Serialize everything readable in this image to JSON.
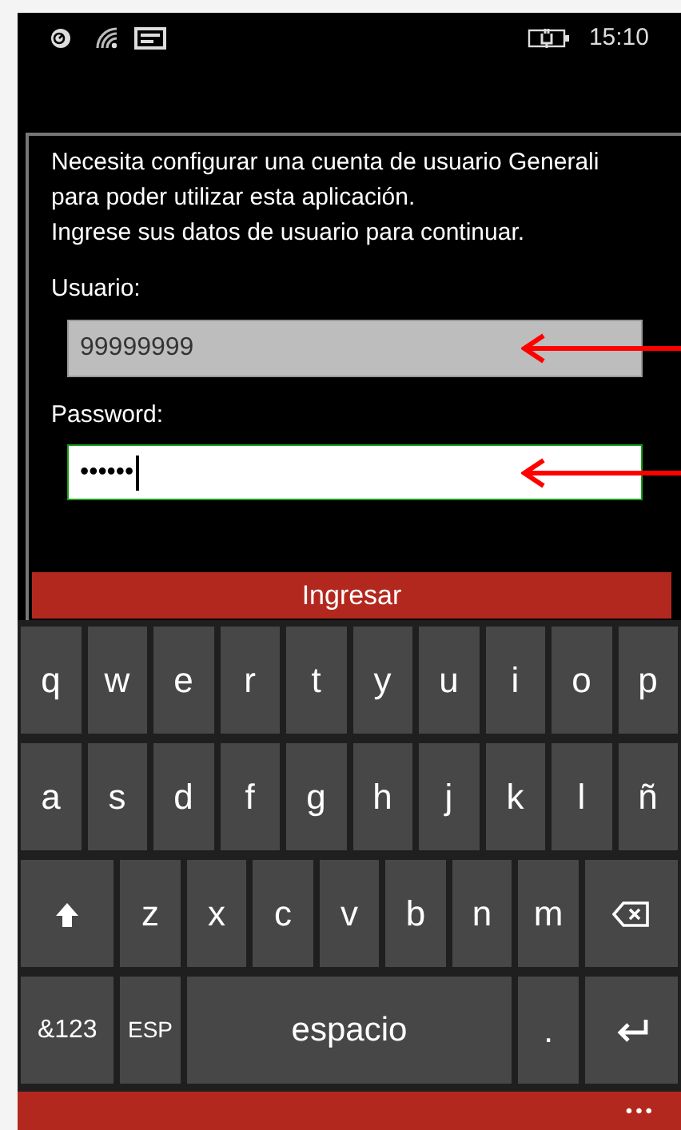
{
  "status_bar": {
    "time": "15:10"
  },
  "message": [
    "Necesita configurar una cuenta de usuario Generali para poder utilizar esta aplicación.",
    "Ingrese sus datos de usuario para continuar."
  ],
  "fields": [
    {
      "label": "Usuario:",
      "value": "99999999",
      "focused": false,
      "annotated": true
    },
    {
      "label": "Password:",
      "value": "••••••",
      "focused": true,
      "annotated": true
    }
  ],
  "button": "Ingresar",
  "keyboard": {
    "rows": [
      {
        "keys": [
          {
            "kind": "char",
            "label": "q"
          },
          {
            "kind": "char",
            "label": "w"
          },
          {
            "kind": "char",
            "label": "e"
          },
          {
            "kind": "char",
            "label": "r"
          },
          {
            "kind": "char",
            "label": "t"
          },
          {
            "kind": "char",
            "label": "y"
          },
          {
            "kind": "char",
            "label": "u"
          },
          {
            "kind": "char",
            "label": "i"
          },
          {
            "kind": "char",
            "label": "o"
          },
          {
            "kind": "char",
            "label": "p"
          }
        ]
      },
      {
        "keys": [
          {
            "kind": "char",
            "label": "a"
          },
          {
            "kind": "char",
            "label": "s"
          },
          {
            "kind": "char",
            "label": "d"
          },
          {
            "kind": "char",
            "label": "f"
          },
          {
            "kind": "char",
            "label": "g"
          },
          {
            "kind": "char",
            "label": "h"
          },
          {
            "kind": "char",
            "label": "j"
          },
          {
            "kind": "char",
            "label": "k"
          },
          {
            "kind": "char",
            "label": "l"
          },
          {
            "kind": "char",
            "label": "ñ"
          }
        ]
      },
      {
        "keys": [
          {
            "kind": "shift"
          },
          {
            "kind": "char",
            "label": "z"
          },
          {
            "kind": "char",
            "label": "x"
          },
          {
            "kind": "char",
            "label": "c"
          },
          {
            "kind": "char",
            "label": "v"
          },
          {
            "kind": "char",
            "label": "b"
          },
          {
            "kind": "char",
            "label": "n"
          },
          {
            "kind": "char",
            "label": "m"
          },
          {
            "kind": "backspace"
          }
        ]
      },
      {
        "keys": [
          {
            "kind": "symbols",
            "label": "&123"
          },
          {
            "kind": "language",
            "label": "ESP"
          },
          {
            "kind": "space",
            "label": "espacio"
          },
          {
            "kind": "char",
            "label": "."
          },
          {
            "kind": "enter"
          }
        ]
      }
    ]
  },
  "app_bar": {
    "more": "•••"
  }
}
